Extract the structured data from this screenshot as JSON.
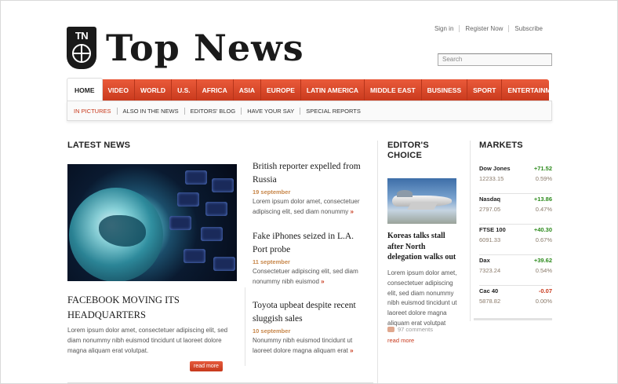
{
  "header": {
    "logo_initials": "TN",
    "logo_text": "Top News",
    "links": [
      "Sign in",
      "Register Now",
      "Subscribe"
    ],
    "search_placeholder": "Search"
  },
  "nav": {
    "items": [
      "HOME",
      "VIDEO",
      "WORLD",
      "U.S.",
      "AFRICA",
      "ASIA",
      "EUROPE",
      "LATIN AMERICA",
      "MIDDLE EAST",
      "BUSINESS",
      "SPORT",
      "ENTERTAINMENT"
    ],
    "sub_items": [
      "IN PICTURES",
      "ALSO IN THE NEWS",
      "EDITORS' BLOG",
      "HAVE YOUR SAY",
      "SPECIAL REPORTS"
    ]
  },
  "latest": {
    "title": "LATEST NEWS",
    "feature": {
      "headline": "FACEBOOK MOVING ITS HEADQUARTERS",
      "body": "Lorem ipsum dolor amet, consectetuer adipiscing elit, sed diam nonummy nibh euismod tincidunt ut laoreet dolore magna aliquam erat volutpat.",
      "button": "read more"
    },
    "stories": [
      {
        "headline": "British reporter expelled from Russia",
        "date": "19 september",
        "text": "Lorem ipsum dolor amet, consectetuer adipiscing elit, sed diam nonummy"
      },
      {
        "headline": "Fake iPhones seized in L.A. Port probe",
        "date": "11 september",
        "text": "Consectetuer adipiscing elit, sed diam nonummy nibh euismod"
      },
      {
        "headline": "Toyota upbeat despite recent sluggish sales",
        "date": "10 september",
        "text": "Nonummy nibh euismod tincidunt ut laoreet dolore magna aliquam erat"
      }
    ]
  },
  "editors": {
    "title_line1": "EDITOR'S",
    "title_line2": "CHOICE",
    "headline": "Koreas talks stall after North delegation walks out",
    "body": "Lorem ipsum dolor amet, consectetuer adipiscing elit, sed diam nonummy nibh euismod tincidunt ut laoreet dolore magna aliquam erat volutpat",
    "comments": "97 comments",
    "read_more": "read more"
  },
  "markets": {
    "title": "MARKETS",
    "rows": [
      {
        "name": "Dow Jones",
        "change": "+71.52",
        "value": "12233.15",
        "pct": "0.59%",
        "dir": "pos"
      },
      {
        "name": "Nasdaq",
        "change": "+13.86",
        "value": "2797.05",
        "pct": "0.47%",
        "dir": "pos"
      },
      {
        "name": "FTSE 100",
        "change": "+40.30",
        "value": "6091.33",
        "pct": "0.67%",
        "dir": "pos"
      },
      {
        "name": "Dax",
        "change": "+39.62",
        "value": "7323.24",
        "pct": "0.54%",
        "dir": "pos"
      },
      {
        "name": "Cac 40",
        "change": "-0.07",
        "value": "5878.82",
        "pct": "0.00%",
        "dir": "neg"
      }
    ]
  },
  "colors": {
    "accent": "#d8452a",
    "date": "#c8874a",
    "positive": "#2c8a1c"
  }
}
